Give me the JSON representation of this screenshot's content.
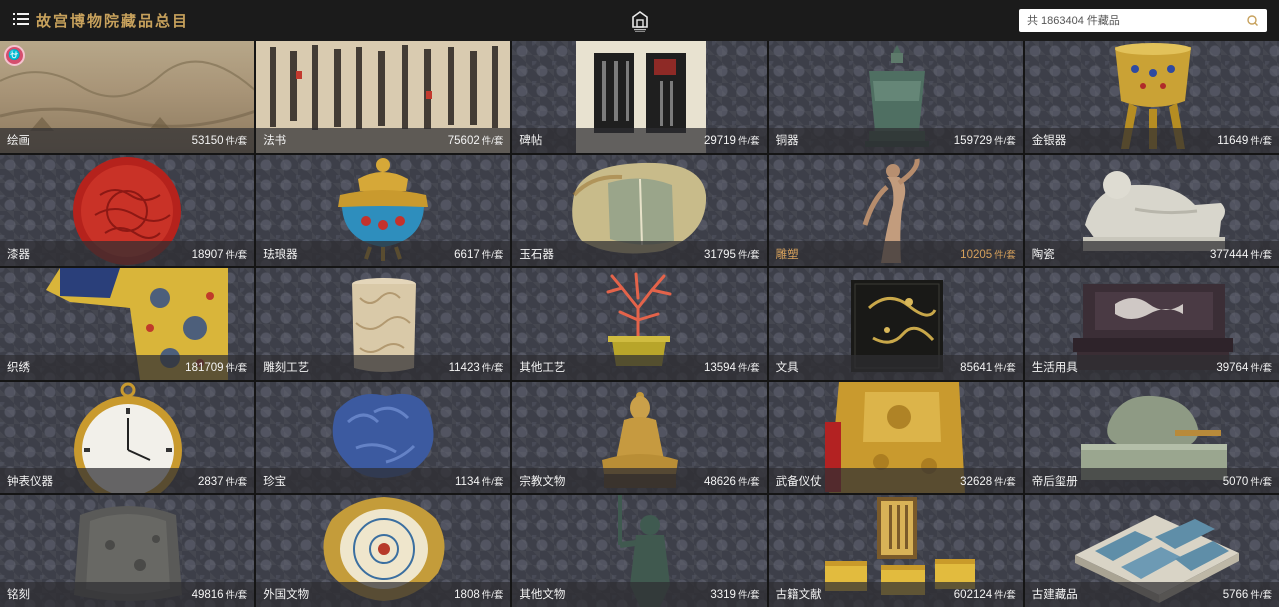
{
  "header": {
    "site_title": "故宫博物院藏品总目",
    "search_placeholder": "共 1863404 件藏品"
  },
  "accessibility_badge": "⛎",
  "unit": "件/套",
  "colors": {
    "accent": "#c7a15c",
    "active_caption": "#d6a15c",
    "badge": "#d54e6e"
  },
  "categories": [
    {
      "name": "绘画",
      "count": "53150"
    },
    {
      "name": "法书",
      "count": "75602"
    },
    {
      "name": "碑帖",
      "count": "29719"
    },
    {
      "name": "铜器",
      "count": "159729"
    },
    {
      "name": "金银器",
      "count": "11649"
    },
    {
      "name": "漆器",
      "count": "18907"
    },
    {
      "name": "珐琅器",
      "count": "6617"
    },
    {
      "name": "玉石器",
      "count": "31795"
    },
    {
      "name": "雕塑",
      "count": "10205"
    },
    {
      "name": "陶瓷",
      "count": "377444"
    },
    {
      "name": "织绣",
      "count": "181709"
    },
    {
      "name": "雕刻工艺",
      "count": "11423"
    },
    {
      "name": "其他工艺",
      "count": "13594"
    },
    {
      "name": "文具",
      "count": "85641"
    },
    {
      "name": "生活用具",
      "count": "39764"
    },
    {
      "name": "钟表仪器",
      "count": "2837"
    },
    {
      "name": "珍宝",
      "count": "1134"
    },
    {
      "name": "宗教文物",
      "count": "48626"
    },
    {
      "name": "武备仪仗",
      "count": "32628"
    },
    {
      "name": "帝后玺册",
      "count": "5070"
    },
    {
      "name": "铭刻",
      "count": "49816"
    },
    {
      "name": "外国文物",
      "count": "1808"
    },
    {
      "name": "其他文物",
      "count": "3319"
    },
    {
      "name": "古籍文献",
      "count": "602124"
    },
    {
      "name": "古建藏品",
      "count": "5766"
    }
  ]
}
